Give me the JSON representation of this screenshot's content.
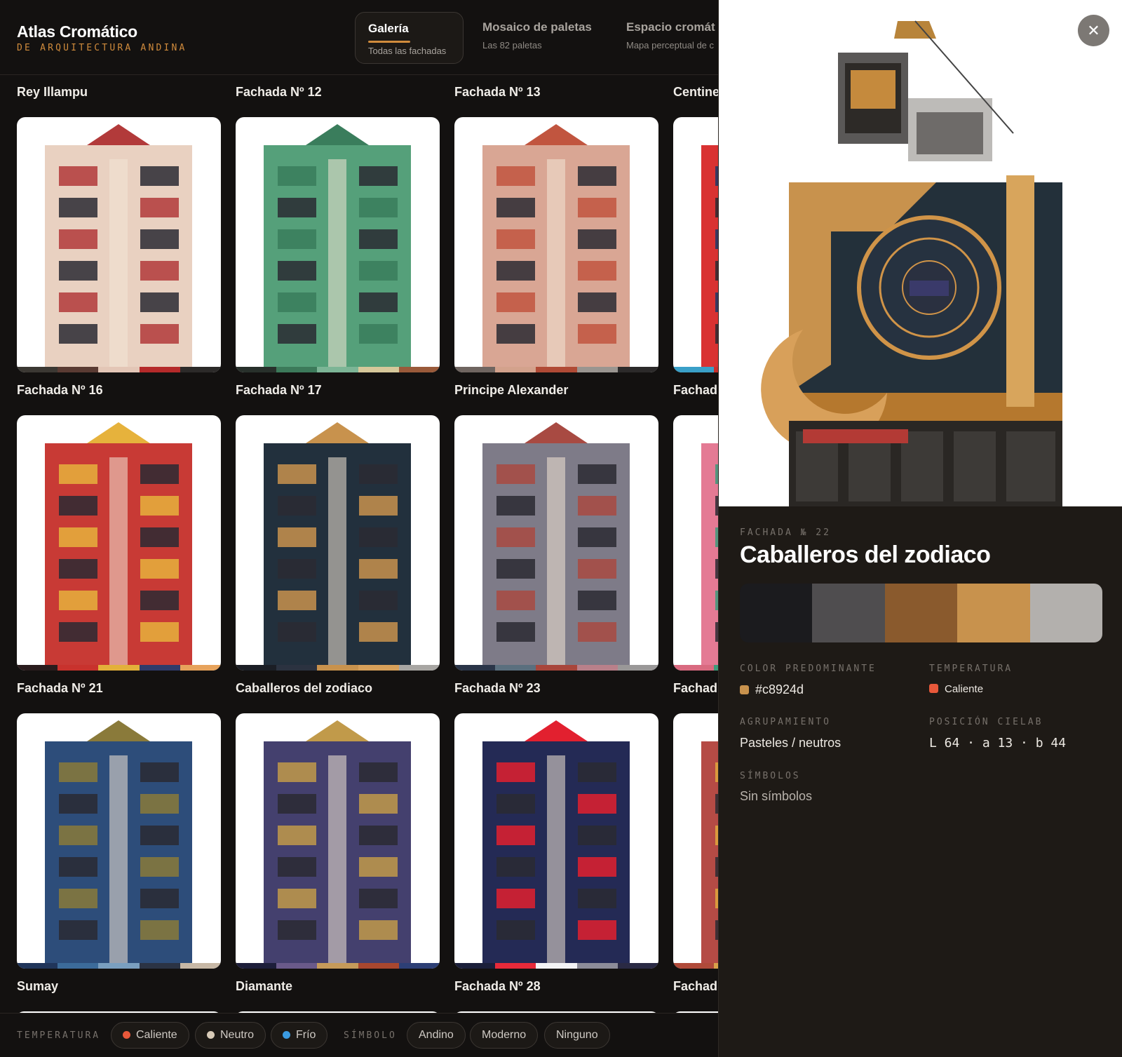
{
  "app": {
    "title": "Atlas Cromático",
    "subtitle": "DE ARQUITECTURA ANDINA",
    "accent": "#d08b3c"
  },
  "tabs": [
    {
      "label": "Galería",
      "sub": "Todas las fachadas",
      "active": true
    },
    {
      "label": "Mosaico de paletas",
      "sub": "Las 82 paletas",
      "active": false
    },
    {
      "label": "Espacio cromát",
      "sub": "Mapa perceptual de c",
      "active": false
    }
  ],
  "gallery": {
    "rows": [
      [
        {
          "title": "Rey Illampu",
          "palette": [
            "#3b3833",
            "#5a3b33",
            "#e3c6b6",
            "#b52a2a",
            "#2c2a29"
          ],
          "bg": "#e9d1c1",
          "accent": "#b23a3a"
        },
        {
          "title": "Fachada Nº 12",
          "palette": [
            "#28302b",
            "#3c7a5a",
            "#7cb596",
            "#d6c89a",
            "#9a5a3a"
          ],
          "bg": "#55a07a",
          "accent": "#3a7d5c"
        },
        {
          "title": "Fachada Nº 13",
          "palette": [
            "#6f6560",
            "#d3a28c",
            "#b04a35",
            "#9a9590",
            "#2c2a2a"
          ],
          "bg": "#d9a694",
          "accent": "#c1553f"
        },
        {
          "title": "Centine",
          "palette": [
            "#3aa0c8",
            "#c9302c",
            "#1b2a4a",
            "#e8e4e2",
            "#777"
          ],
          "bg": "#d93232",
          "accent": "#1c3a68"
        }
      ],
      [
        {
          "title": "Fachada Nº 16",
          "palette": [
            "#2a1c1d",
            "#c8322d",
            "#e3b03a",
            "#2f3b6a",
            "#e7a35c"
          ],
          "bg": "#c83a35",
          "accent": "#e6b23c"
        },
        {
          "title": "Fachada Nº 17",
          "palette": [
            "#1b1e25",
            "#2b3240",
            "#c8924d",
            "#d7a05a",
            "#a8a6a3"
          ],
          "bg": "#22303d",
          "accent": "#c8924d"
        },
        {
          "title": "Principe Alexander",
          "palette": [
            "#2a3548",
            "#5a6f7e",
            "#a8453b",
            "#b9808a",
            "#9a9898"
          ],
          "bg": "#7e7b88",
          "accent": "#a84a42"
        },
        {
          "title": "Fachad",
          "palette": [
            "#d96a80",
            "#3d9b7a",
            "#c4c4c4",
            "#777",
            "#333"
          ],
          "bg": "#e47a94",
          "accent": "#3c9a7a"
        }
      ],
      [
        {
          "title": "Fachada Nº 21",
          "palette": [
            "#20355a",
            "#3c6b9a",
            "#7a9fbf",
            "#2b3344",
            "#c7b8a6"
          ],
          "bg": "#2d4d7a",
          "accent": "#8a7a3a"
        },
        {
          "title": "Caballeros del zodiaco",
          "palette": [
            "#1d1e3a",
            "#6a5a8a",
            "#c59a5a",
            "#a8472f",
            "#2d3f75"
          ],
          "bg": "#44406e",
          "accent": "#c19a4a"
        },
        {
          "title": "Fachada Nº 28",
          "palette": [
            "#1b1f3a",
            "#e62a3a",
            "#f3f3f5",
            "#8c8c99",
            "#2a2a44"
          ],
          "bg": "#242a55",
          "accent": "#e2202f"
        },
        {
          "title": "Fachad",
          "palette": [
            "#b04a3a",
            "#d9a14a",
            "#8a5a5a",
            "#4a4a4a",
            "#ccc"
          ],
          "bg": "#b54b45",
          "accent": "#e0a83c"
        }
      ]
    ],
    "rowTitles": [
      [
        "Rey Illampu",
        "Fachada Nº 12",
        "Fachada Nº 13",
        "Centine"
      ],
      [
        "Fachada Nº 16",
        "Fachada Nº 17",
        "Principe Alexander",
        "Fachad"
      ],
      [
        "Fachada Nº 21",
        "Caballeros del zodiaco",
        "Fachada Nº 23",
        "Fachad"
      ],
      [
        "Sumay",
        "Diamante",
        "Fachada Nº 28",
        "Fachad"
      ]
    ]
  },
  "filters": {
    "temperature_label": "TEMPERATURA",
    "symbol_label": "SÍMBOLO",
    "temperature": [
      {
        "label": "Caliente",
        "color": "#e8583a"
      },
      {
        "label": "Neutro",
        "color": "#d8cbb8"
      },
      {
        "label": "Frío",
        "color": "#3a9ae0"
      }
    ],
    "symbol": [
      "Andino",
      "Moderno",
      "Ninguno"
    ]
  },
  "detail": {
    "close_icon": "close-icon",
    "eyebrow": "FACHADA № 22",
    "title": "Caballeros del zodiaco",
    "palette": [
      "#1b1b1e",
      "#4f4d4f",
      "#8a5a2d",
      "#c8924d",
      "#b3b0ad"
    ],
    "fields": {
      "predominant_label": "COLOR PREDOMINANTE",
      "predominant_value": "#c8924d",
      "predominant_color": "#c8924d",
      "temperature_label": "TEMPERATURA",
      "temperature_value": "Caliente",
      "temperature_color": "#e8583a",
      "grouping_label": "AGRUPAMIENTO",
      "grouping_value": "Pasteles / neutros",
      "cielab_label": "POSICIÓN CIELAB",
      "cielab_value": "L 64 · a 13 · b 44",
      "symbols_label": "SÍMBOLOS",
      "symbols_value": "Sin símbolos"
    }
  }
}
